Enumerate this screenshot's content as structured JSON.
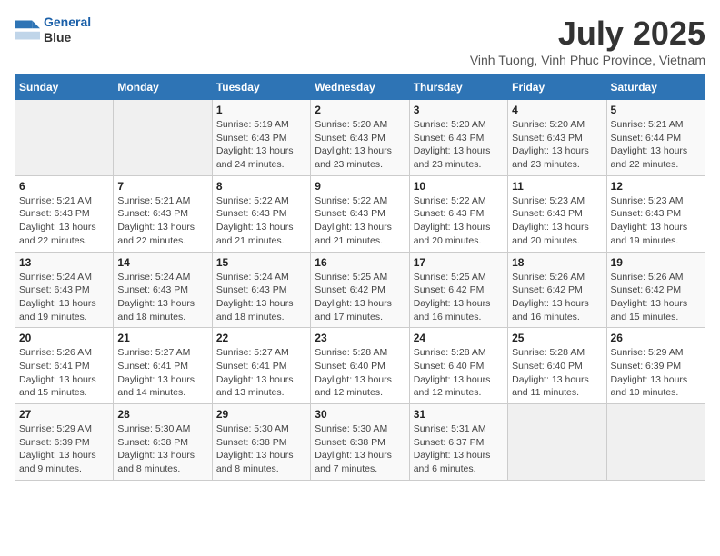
{
  "logo": {
    "line1": "General",
    "line2": "Blue"
  },
  "title": "July 2025",
  "subtitle": "Vinh Tuong, Vinh Phuc Province, Vietnam",
  "weekdays": [
    "Sunday",
    "Monday",
    "Tuesday",
    "Wednesday",
    "Thursday",
    "Friday",
    "Saturday"
  ],
  "weeks": [
    [
      {
        "day": "",
        "sunrise": "",
        "sunset": "",
        "daylight": "",
        "empty": true
      },
      {
        "day": "",
        "sunrise": "",
        "sunset": "",
        "daylight": "",
        "empty": true
      },
      {
        "day": "1",
        "sunrise": "Sunrise: 5:19 AM",
        "sunset": "Sunset: 6:43 PM",
        "daylight": "Daylight: 13 hours and 24 minutes."
      },
      {
        "day": "2",
        "sunrise": "Sunrise: 5:20 AM",
        "sunset": "Sunset: 6:43 PM",
        "daylight": "Daylight: 13 hours and 23 minutes."
      },
      {
        "day": "3",
        "sunrise": "Sunrise: 5:20 AM",
        "sunset": "Sunset: 6:43 PM",
        "daylight": "Daylight: 13 hours and 23 minutes."
      },
      {
        "day": "4",
        "sunrise": "Sunrise: 5:20 AM",
        "sunset": "Sunset: 6:43 PM",
        "daylight": "Daylight: 13 hours and 23 minutes."
      },
      {
        "day": "5",
        "sunrise": "Sunrise: 5:21 AM",
        "sunset": "Sunset: 6:44 PM",
        "daylight": "Daylight: 13 hours and 22 minutes."
      }
    ],
    [
      {
        "day": "6",
        "sunrise": "Sunrise: 5:21 AM",
        "sunset": "Sunset: 6:43 PM",
        "daylight": "Daylight: 13 hours and 22 minutes."
      },
      {
        "day": "7",
        "sunrise": "Sunrise: 5:21 AM",
        "sunset": "Sunset: 6:43 PM",
        "daylight": "Daylight: 13 hours and 22 minutes."
      },
      {
        "day": "8",
        "sunrise": "Sunrise: 5:22 AM",
        "sunset": "Sunset: 6:43 PM",
        "daylight": "Daylight: 13 hours and 21 minutes."
      },
      {
        "day": "9",
        "sunrise": "Sunrise: 5:22 AM",
        "sunset": "Sunset: 6:43 PM",
        "daylight": "Daylight: 13 hours and 21 minutes."
      },
      {
        "day": "10",
        "sunrise": "Sunrise: 5:22 AM",
        "sunset": "Sunset: 6:43 PM",
        "daylight": "Daylight: 13 hours and 20 minutes."
      },
      {
        "day": "11",
        "sunrise": "Sunrise: 5:23 AM",
        "sunset": "Sunset: 6:43 PM",
        "daylight": "Daylight: 13 hours and 20 minutes."
      },
      {
        "day": "12",
        "sunrise": "Sunrise: 5:23 AM",
        "sunset": "Sunset: 6:43 PM",
        "daylight": "Daylight: 13 hours and 19 minutes."
      }
    ],
    [
      {
        "day": "13",
        "sunrise": "Sunrise: 5:24 AM",
        "sunset": "Sunset: 6:43 PM",
        "daylight": "Daylight: 13 hours and 19 minutes."
      },
      {
        "day": "14",
        "sunrise": "Sunrise: 5:24 AM",
        "sunset": "Sunset: 6:43 PM",
        "daylight": "Daylight: 13 hours and 18 minutes."
      },
      {
        "day": "15",
        "sunrise": "Sunrise: 5:24 AM",
        "sunset": "Sunset: 6:43 PM",
        "daylight": "Daylight: 13 hours and 18 minutes."
      },
      {
        "day": "16",
        "sunrise": "Sunrise: 5:25 AM",
        "sunset": "Sunset: 6:42 PM",
        "daylight": "Daylight: 13 hours and 17 minutes."
      },
      {
        "day": "17",
        "sunrise": "Sunrise: 5:25 AM",
        "sunset": "Sunset: 6:42 PM",
        "daylight": "Daylight: 13 hours and 16 minutes."
      },
      {
        "day": "18",
        "sunrise": "Sunrise: 5:26 AM",
        "sunset": "Sunset: 6:42 PM",
        "daylight": "Daylight: 13 hours and 16 minutes."
      },
      {
        "day": "19",
        "sunrise": "Sunrise: 5:26 AM",
        "sunset": "Sunset: 6:42 PM",
        "daylight": "Daylight: 13 hours and 15 minutes."
      }
    ],
    [
      {
        "day": "20",
        "sunrise": "Sunrise: 5:26 AM",
        "sunset": "Sunset: 6:41 PM",
        "daylight": "Daylight: 13 hours and 15 minutes."
      },
      {
        "day": "21",
        "sunrise": "Sunrise: 5:27 AM",
        "sunset": "Sunset: 6:41 PM",
        "daylight": "Daylight: 13 hours and 14 minutes."
      },
      {
        "day": "22",
        "sunrise": "Sunrise: 5:27 AM",
        "sunset": "Sunset: 6:41 PM",
        "daylight": "Daylight: 13 hours and 13 minutes."
      },
      {
        "day": "23",
        "sunrise": "Sunrise: 5:28 AM",
        "sunset": "Sunset: 6:40 PM",
        "daylight": "Daylight: 13 hours and 12 minutes."
      },
      {
        "day": "24",
        "sunrise": "Sunrise: 5:28 AM",
        "sunset": "Sunset: 6:40 PM",
        "daylight": "Daylight: 13 hours and 12 minutes."
      },
      {
        "day": "25",
        "sunrise": "Sunrise: 5:28 AM",
        "sunset": "Sunset: 6:40 PM",
        "daylight": "Daylight: 13 hours and 11 minutes."
      },
      {
        "day": "26",
        "sunrise": "Sunrise: 5:29 AM",
        "sunset": "Sunset: 6:39 PM",
        "daylight": "Daylight: 13 hours and 10 minutes."
      }
    ],
    [
      {
        "day": "27",
        "sunrise": "Sunrise: 5:29 AM",
        "sunset": "Sunset: 6:39 PM",
        "daylight": "Daylight: 13 hours and 9 minutes."
      },
      {
        "day": "28",
        "sunrise": "Sunrise: 5:30 AM",
        "sunset": "Sunset: 6:38 PM",
        "daylight": "Daylight: 13 hours and 8 minutes."
      },
      {
        "day": "29",
        "sunrise": "Sunrise: 5:30 AM",
        "sunset": "Sunset: 6:38 PM",
        "daylight": "Daylight: 13 hours and 8 minutes."
      },
      {
        "day": "30",
        "sunrise": "Sunrise: 5:30 AM",
        "sunset": "Sunset: 6:38 PM",
        "daylight": "Daylight: 13 hours and 7 minutes."
      },
      {
        "day": "31",
        "sunrise": "Sunrise: 5:31 AM",
        "sunset": "Sunset: 6:37 PM",
        "daylight": "Daylight: 13 hours and 6 minutes."
      },
      {
        "day": "",
        "sunrise": "",
        "sunset": "",
        "daylight": "",
        "empty": true
      },
      {
        "day": "",
        "sunrise": "",
        "sunset": "",
        "daylight": "",
        "empty": true
      }
    ]
  ]
}
